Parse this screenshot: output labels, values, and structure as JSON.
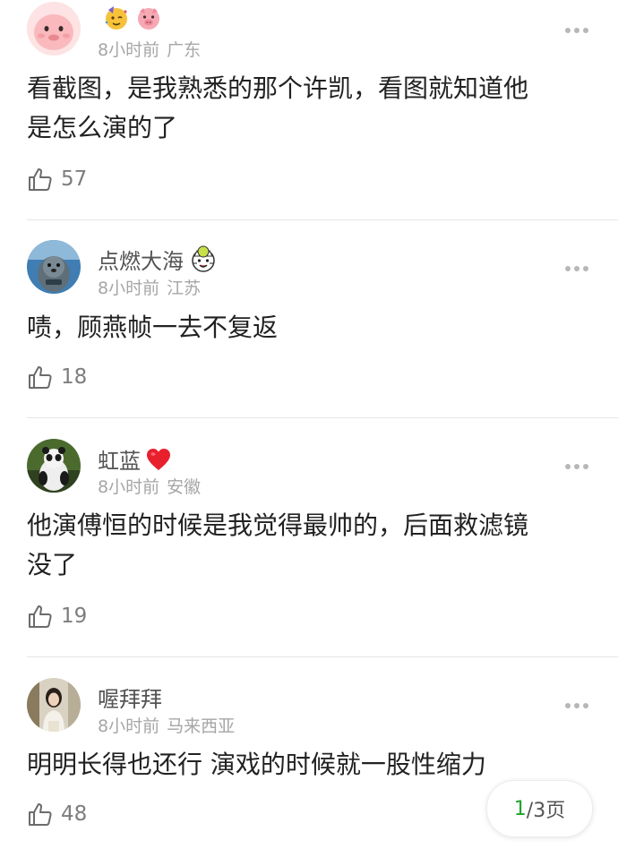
{
  "comments": [
    {
      "username": "",
      "badges": [
        "party-face-icon",
        "pig-face-icon"
      ],
      "time": "8小时前",
      "location": "广东",
      "content_lines": [
        "看截图，是我熟悉的那个许凯，看图就知道他",
        "是怎么演的了"
      ],
      "likes": "57"
    },
    {
      "username": "点燃大海",
      "badges": [
        "tiger-face-icon"
      ],
      "time": "8小时前",
      "location": "江苏",
      "content_lines": [
        "啧，顾燕帧一去不复返"
      ],
      "likes": "18"
    },
    {
      "username": "虹蓝",
      "badges": [
        "red-heart-icon"
      ],
      "time": "8小时前",
      "location": "安徽",
      "content_lines": [
        "他演傅恒的时候是我觉得最帅的，后面救滤镜",
        "没了"
      ],
      "likes": "19"
    },
    {
      "username": "喔拜拜",
      "badges": [],
      "time": "8小时前",
      "location": "马来西亚",
      "content_lines": [
        "明明长得也还行 演戏的时候就一股性缩力"
      ],
      "likes": "48"
    }
  ],
  "pager": {
    "current": "1",
    "rest": "/3页"
  },
  "colors": {
    "accent": "#1fa32b",
    "meta": "#a6a6a6",
    "text": "#222222"
  }
}
